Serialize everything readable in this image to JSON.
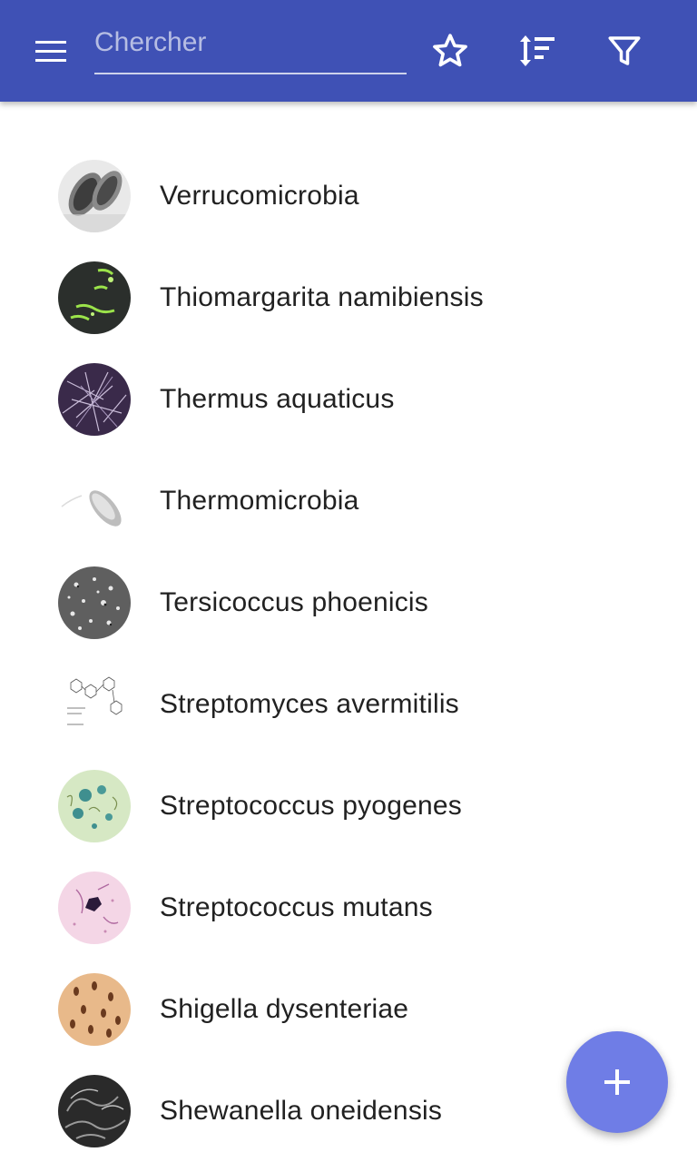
{
  "appbar": {
    "background": "#3f51b5",
    "menu_icon": "menu-icon",
    "search": {
      "placeholder": "Chercher",
      "value": ""
    },
    "actions": [
      "star-icon",
      "sort-icon",
      "filter-icon"
    ]
  },
  "list": {
    "items": [
      {
        "label": "Verrucomicrobia",
        "thumb": "microscope-thumbnail"
      },
      {
        "label": "Thiomargarita namibiensis",
        "thumb": "microscope-thumbnail"
      },
      {
        "label": "Thermus aquaticus",
        "thumb": "microscope-thumbnail"
      },
      {
        "label": "Thermomicrobia",
        "thumb": "microscope-thumbnail"
      },
      {
        "label": "Tersicoccus phoenicis",
        "thumb": "microscope-thumbnail"
      },
      {
        "label": "Streptomyces avermitilis",
        "thumb": "structure-diagram-thumbnail"
      },
      {
        "label": "Streptococcus pyogenes",
        "thumb": "microscope-thumbnail"
      },
      {
        "label": "Streptococcus mutans",
        "thumb": "microscope-thumbnail"
      },
      {
        "label": "Shigella dysenteriae",
        "thumb": "microscope-thumbnail"
      },
      {
        "label": "Shewanella oneidensis",
        "thumb": "microscope-thumbnail"
      }
    ]
  },
  "fab": {
    "icon": "plus-icon",
    "color": "#6f7de6"
  }
}
